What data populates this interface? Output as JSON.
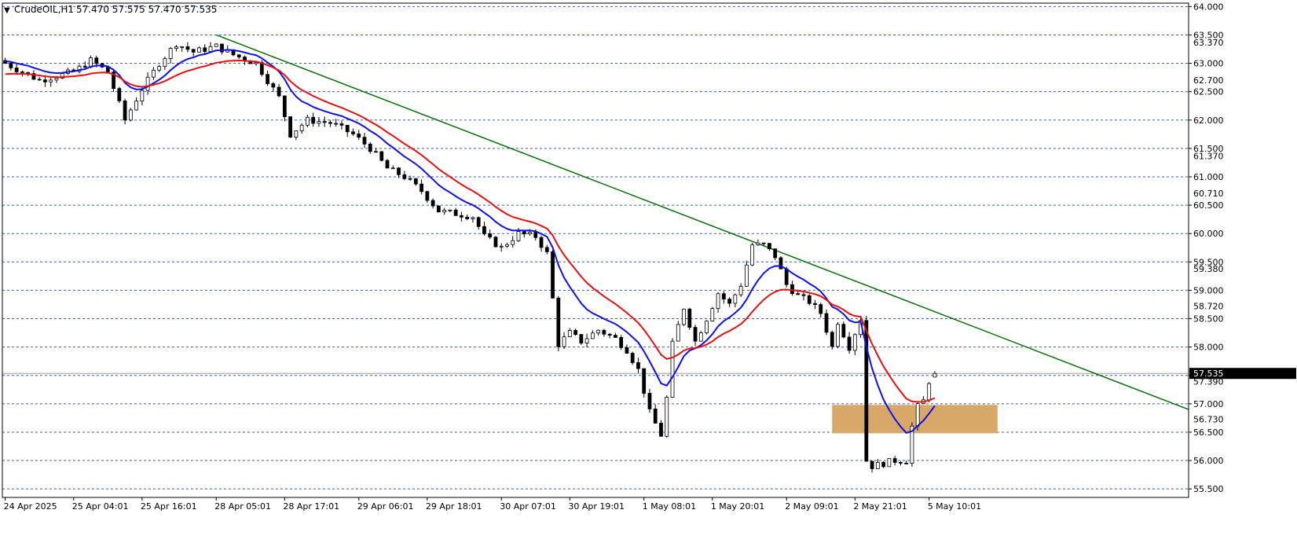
{
  "header": {
    "arrow_glyph": "▼",
    "symbol": "CrudeOIL,H1",
    "ohlc": "57.470 57.575 57.470 57.535"
  },
  "colors": {
    "background": "#ffffff",
    "frame": "#000000",
    "grid": "#3c5ec8",
    "ema_fast": "#1010e8",
    "ema_slow": "#e81010",
    "trendline": "#0a6e0a",
    "zone": "#d8a868",
    "candle_bull": "#ffffff",
    "candle_bear": "#000000",
    "price_label_bg": "#000000",
    "price_label_fg": "#ffffff"
  },
  "chart_data": {
    "type": "candlestick",
    "symbol": "CrudeOIL",
    "timeframe": "H1",
    "ylim": [
      55.35,
      64.06
    ],
    "bar_count": 208,
    "grid": true,
    "grid_levels": [
      64.0,
      63.5,
      63.0,
      62.5,
      62.0,
      61.5,
      61.0,
      60.5,
      60.0,
      59.5,
      59.0,
      58.5,
      58.0,
      57.5,
      57.0,
      56.5,
      56.0,
      55.5
    ],
    "labeled_levels": [
      "64.000",
      "63.500",
      "63.000",
      "62.500",
      "62.000",
      "61.500",
      "61.000",
      "60.500",
      "60.000",
      "59.500",
      "59.000",
      "58.500",
      "58.000",
      "57.500",
      "57.000",
      "56.500",
      "56.000",
      "55.500"
    ],
    "intermediate_ticks": [
      "63.370",
      "62.700",
      "61.370",
      "60.710",
      "59.380",
      "58.720",
      "57.390",
      "56.730"
    ],
    "current_price": 57.535,
    "x_tick_labels": [
      {
        "i": 0,
        "label": "24 Apr 2025"
      },
      {
        "i": 12,
        "label": "25 Apr 04:01"
      },
      {
        "i": 24,
        "label": "25 Apr 16:01"
      },
      {
        "i": 37,
        "label": "28 Apr 05:01"
      },
      {
        "i": 49,
        "label": "28 Apr 17:01"
      },
      {
        "i": 62,
        "label": "29 Apr 06:01"
      },
      {
        "i": 74,
        "label": "29 Apr 18:01"
      },
      {
        "i": 87,
        "label": "30 Apr 07:01"
      },
      {
        "i": 99,
        "label": "30 Apr 19:01"
      },
      {
        "i": 112,
        "label": "1 May 08:01"
      },
      {
        "i": 124,
        "label": "1 May 20:01"
      },
      {
        "i": 137,
        "label": "2 May 09:01"
      },
      {
        "i": 149,
        "label": "2 May 21:01"
      },
      {
        "i": 162,
        "label": "5 May 10:01"
      }
    ],
    "close_anchors": [
      [
        0,
        63.0
      ],
      [
        6,
        62.7
      ],
      [
        12,
        62.85
      ],
      [
        15,
        63.05
      ],
      [
        18,
        62.85
      ],
      [
        21,
        62.0
      ],
      [
        24,
        62.55
      ],
      [
        27,
        63.0
      ],
      [
        30,
        63.35
      ],
      [
        33,
        63.2
      ],
      [
        37,
        63.3
      ],
      [
        40,
        63.15
      ],
      [
        44,
        63.0
      ],
      [
        48,
        62.4
      ],
      [
        50,
        61.75
      ],
      [
        53,
        62.0
      ],
      [
        57,
        61.95
      ],
      [
        61,
        61.75
      ],
      [
        64,
        61.5
      ],
      [
        67,
        61.15
      ],
      [
        70,
        61.0
      ],
      [
        73,
        60.75
      ],
      [
        76,
        60.4
      ],
      [
        79,
        60.35
      ],
      [
        82,
        60.3
      ],
      [
        84,
        59.95
      ],
      [
        87,
        59.75
      ],
      [
        90,
        60.0
      ],
      [
        93,
        59.95
      ],
      [
        95,
        59.65
      ],
      [
        97,
        58.05
      ],
      [
        99,
        58.25
      ],
      [
        101,
        58.1
      ],
      [
        104,
        58.3
      ],
      [
        107,
        58.15
      ],
      [
        109,
        57.95
      ],
      [
        111,
        57.6
      ],
      [
        113,
        56.85
      ],
      [
        115,
        56.45
      ],
      [
        116,
        57.1
      ],
      [
        117,
        58.05
      ],
      [
        119,
        58.7
      ],
      [
        121,
        58.1
      ],
      [
        123,
        58.5
      ],
      [
        125,
        58.95
      ],
      [
        127,
        58.75
      ],
      [
        129,
        59.1
      ],
      [
        131,
        59.8
      ],
      [
        133,
        59.8
      ],
      [
        135,
        59.6
      ],
      [
        137,
        59.1
      ],
      [
        139,
        58.9
      ],
      [
        141,
        58.8
      ],
      [
        143,
        58.6
      ],
      [
        145,
        58.0
      ],
      [
        146,
        58.45
      ],
      [
        148,
        58.0
      ],
      [
        150,
        58.5
      ],
      [
        151,
        56.0
      ],
      [
        152,
        55.9
      ],
      [
        154,
        55.95
      ],
      [
        156,
        56.0
      ],
      [
        158,
        56.0
      ],
      [
        159,
        56.6
      ],
      [
        160,
        56.95
      ],
      [
        161,
        57.05
      ],
      [
        162,
        57.4
      ],
      [
        163,
        57.535
      ]
    ],
    "series": [
      {
        "name": "",
        "kind": "ema",
        "period": 10,
        "color": "#1010e8"
      },
      {
        "name": "",
        "kind": "ema",
        "period": 20,
        "color": "#e81010"
      }
    ],
    "trendline": {
      "start": {
        "i": 37,
        "price": 63.5
      },
      "end": {
        "i": 208,
        "price": 56.9
      },
      "color": "#0a6e0a"
    },
    "zone": {
      "start_i": 145,
      "end_i": 174,
      "low": 56.48,
      "high": 56.98,
      "color": "#d8a868"
    }
  }
}
